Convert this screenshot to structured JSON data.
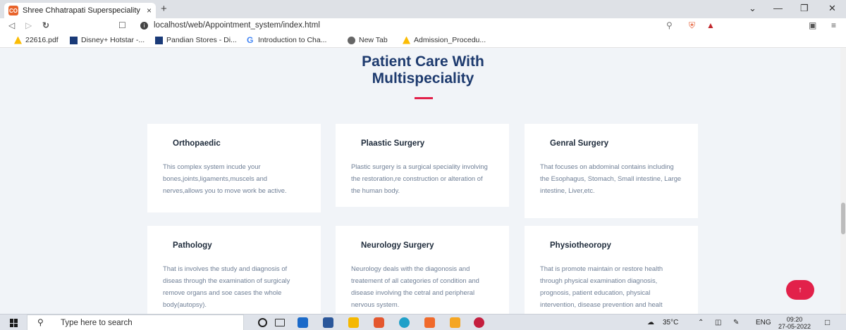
{
  "browser": {
    "tab_title": "Shree Chhatrapati Superspeciality",
    "tab_icon_text": "CO",
    "tab_close": "×",
    "new_tab": "+",
    "url": "localhost/web/Appointment_system/index.html",
    "bookmarks": [
      {
        "label": "22616.pdf"
      },
      {
        "label": "Disney+ Hotstar -..."
      },
      {
        "label": "Pandian Stores - Di..."
      },
      {
        "label": "Introduction to Cha..."
      },
      {
        "label": "New Tab"
      },
      {
        "label": "Admission_Procedu..."
      }
    ]
  },
  "page": {
    "heading_line1": "Patient Care With",
    "heading_line2": "Multispeciality",
    "accent_color": "#e2214a",
    "services": [
      {
        "title": "Orthopaedic",
        "text": "This complex system incude your bones,joints,ligaments,muscels and nerves,allows you to move work be active."
      },
      {
        "title": "Plaastic Surgery",
        "text": "Plastic surgery is a surgical speciality involving the restoration,re construction or alteration of the human body."
      },
      {
        "title": "Genral Surgery",
        "text": "That focuses on abdominal contains including the Esophagus, Stomach, Small intestine, Large intestine, Liver,etc."
      },
      {
        "title": "Pathology",
        "text": "That is involves the study and diagnosis of diseas through the examination of surgicaly remove organs and soe cases the whole body(autopsy)."
      },
      {
        "title": "Neurology Surgery",
        "text": "Neurology deals with the diagonosis and treatement of all categories of condition and disease involving the cetral and peripheral nervous system."
      },
      {
        "title": "Physiotheoropy",
        "text": "That is promote maintain or restore health through physical examination diagnosis, prognosis, patient education, physical intervention, disease prevention and healt promotion."
      }
    ],
    "back_to_top": "↑"
  },
  "taskbar": {
    "search_placeholder": "Type here to search",
    "temperature": "35°C",
    "language": "ENG",
    "time": "09:20",
    "date": "27-05-2022"
  }
}
